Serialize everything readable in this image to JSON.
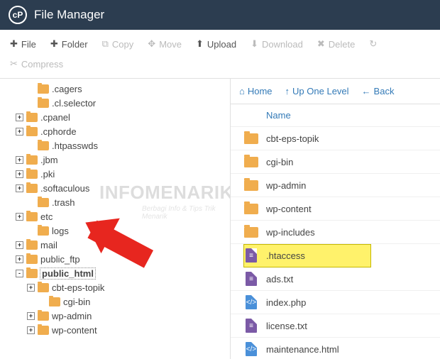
{
  "header": {
    "title": "File Manager"
  },
  "toolbar": {
    "file": "File",
    "folder": "Folder",
    "copy": "Copy",
    "move": "Move",
    "upload": "Upload",
    "download": "Download",
    "delete": "Delete",
    "compress": "Compress"
  },
  "tree": {
    "items": [
      {
        "depth": 2,
        "exp": "",
        "label": ".cagers"
      },
      {
        "depth": 2,
        "exp": "",
        "label": ".cl.selector"
      },
      {
        "depth": 1,
        "exp": "+",
        "label": ".cpanel"
      },
      {
        "depth": 1,
        "exp": "+",
        "label": ".cphorde"
      },
      {
        "depth": 2,
        "exp": "",
        "label": ".htpasswds"
      },
      {
        "depth": 1,
        "exp": "+",
        "label": ".jbm"
      },
      {
        "depth": 1,
        "exp": "+",
        "label": ".pki"
      },
      {
        "depth": 1,
        "exp": "+",
        "label": ".softaculous"
      },
      {
        "depth": 2,
        "exp": "",
        "label": ".trash"
      },
      {
        "depth": 1,
        "exp": "+",
        "label": "etc"
      },
      {
        "depth": 2,
        "exp": "",
        "label": "logs"
      },
      {
        "depth": 1,
        "exp": "+",
        "label": "mail"
      },
      {
        "depth": 1,
        "exp": "+",
        "label": "public_ftp"
      },
      {
        "depth": 1,
        "exp": "-",
        "label": "public_html",
        "selected": true
      },
      {
        "depth": 2,
        "exp": "+",
        "label": "cbt-eps-topik"
      },
      {
        "depth": 3,
        "exp": "",
        "label": "cgi-bin"
      },
      {
        "depth": 2,
        "exp": "+",
        "label": "wp-admin"
      },
      {
        "depth": 2,
        "exp": "+",
        "label": "wp-content"
      }
    ]
  },
  "filenav": {
    "home": "Home",
    "up": "Up One Level",
    "back": "Back"
  },
  "filelist": {
    "header": "Name",
    "items": [
      {
        "type": "folder",
        "name": "cbt-eps-topik"
      },
      {
        "type": "folder",
        "name": "cgi-bin"
      },
      {
        "type": "folder",
        "name": "wp-admin"
      },
      {
        "type": "folder",
        "name": "wp-content"
      },
      {
        "type": "folder",
        "name": "wp-includes"
      },
      {
        "type": "file-purple",
        "name": ".htaccess",
        "highlight": true
      },
      {
        "type": "file-purple",
        "name": "ads.txt"
      },
      {
        "type": "file-blue",
        "name": "index.php"
      },
      {
        "type": "file-purple",
        "name": "license.txt"
      },
      {
        "type": "file-blue",
        "name": "maintenance.html"
      }
    ]
  },
  "watermark": {
    "main": "INFOMENARIK",
    "sub": "Berbagi Info & Tips Trik Menarik"
  }
}
